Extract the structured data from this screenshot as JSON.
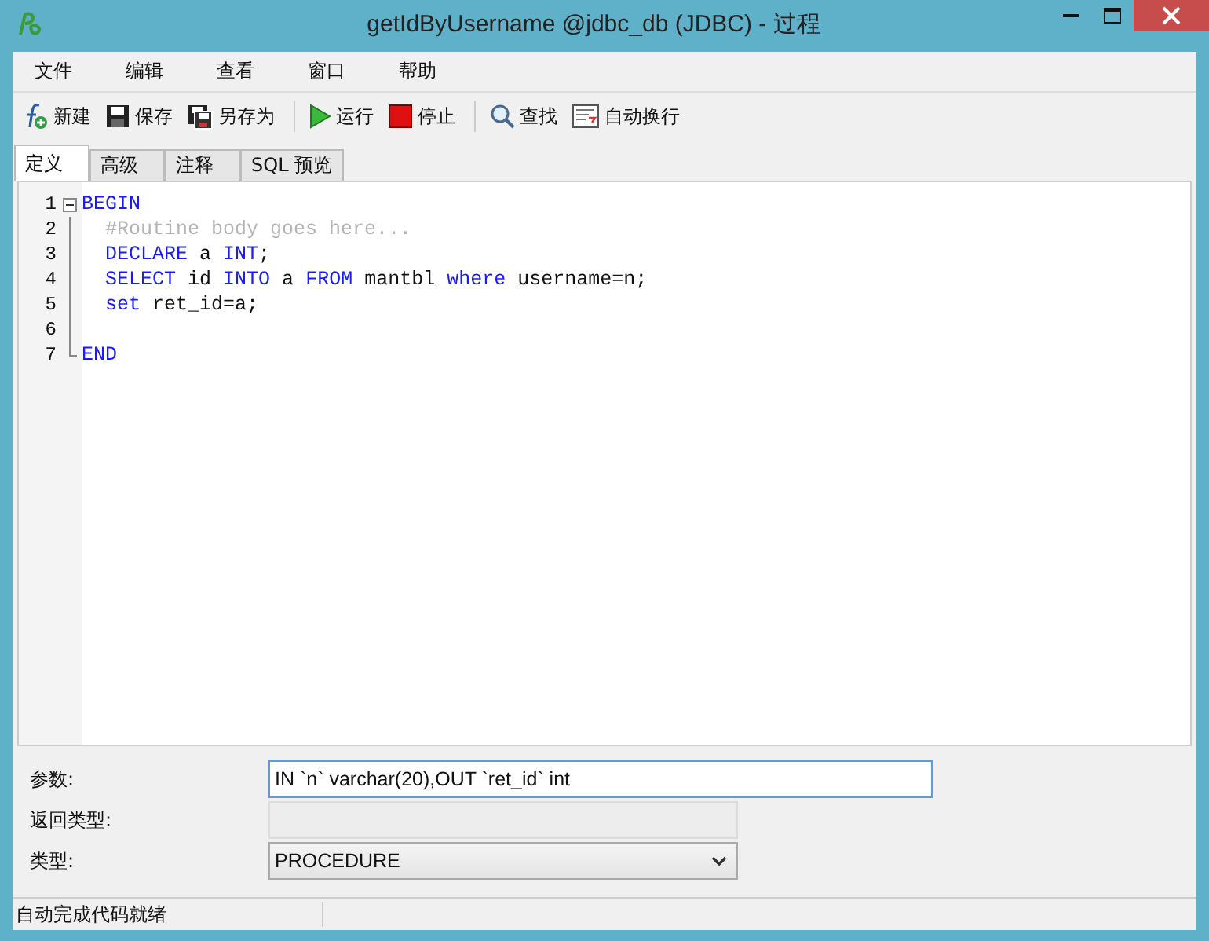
{
  "window": {
    "title": "getIdByUsername @jdbc_db (JDBC) - 过程"
  },
  "menu": [
    "文件",
    "编辑",
    "查看",
    "窗口",
    "帮助"
  ],
  "toolbar": [
    {
      "kind": "new",
      "label": "新建"
    },
    {
      "kind": "save",
      "label": "保存"
    },
    {
      "kind": "saveas",
      "label": "另存为"
    },
    {
      "kind": "run",
      "label": "运行",
      "group_start": true
    },
    {
      "kind": "stop",
      "label": "停止"
    },
    {
      "kind": "find",
      "label": "查找",
      "group_start": true
    },
    {
      "kind": "wrap",
      "label": "自动换行"
    }
  ],
  "tabs": [
    {
      "label": "定义",
      "selected": true
    },
    {
      "label": "高级",
      "selected": false
    },
    {
      "label": "注释",
      "selected": false
    },
    {
      "label": "SQL 预览",
      "selected": false
    }
  ],
  "editor": {
    "lines": [
      {
        "number": "1",
        "fold_start": true,
        "indented": false,
        "tokens": [
          {
            "text": "BEGIN",
            "kind": "keyword"
          }
        ]
      },
      {
        "number": "2",
        "indented": true,
        "tokens": [
          {
            "text": "#Routine body goes here...",
            "kind": "comment"
          }
        ]
      },
      {
        "number": "3",
        "indented": true,
        "tokens": [
          {
            "text": "DECLARE",
            "kind": "keyword"
          },
          {
            "text": " a ",
            "kind": "plain"
          },
          {
            "text": "INT",
            "kind": "keyword"
          },
          {
            "text": ";",
            "kind": "plain"
          }
        ]
      },
      {
        "number": "4",
        "indented": true,
        "tokens": [
          {
            "text": "SELECT",
            "kind": "keyword"
          },
          {
            "text": " id ",
            "kind": "plain"
          },
          {
            "text": "INTO",
            "kind": "keyword"
          },
          {
            "text": " a ",
            "kind": "plain"
          },
          {
            "text": "FROM",
            "kind": "keyword"
          },
          {
            "text": " mantbl ",
            "kind": "plain"
          },
          {
            "text": "where",
            "kind": "keyword"
          },
          {
            "text": " username=n;",
            "kind": "plain"
          }
        ]
      },
      {
        "number": "5",
        "indented": true,
        "tokens": [
          {
            "text": "set",
            "kind": "keyword"
          },
          {
            "text": " ret_id=a;",
            "kind": "plain"
          }
        ]
      },
      {
        "number": "6"
      },
      {
        "number": "7",
        "fold_end": true,
        "indented": false,
        "tokens": [
          {
            "text": "END",
            "kind": "keyword"
          }
        ]
      }
    ]
  },
  "form": [
    {
      "label": "参数:",
      "kind": "input",
      "value": "IN `n` varchar(20),OUT `ret_id` int"
    },
    {
      "label": "返回类型:",
      "kind": "disabled"
    },
    {
      "label": "类型:",
      "kind": "select",
      "value": "PROCEDURE"
    }
  ],
  "status_bar": "自动完成代码就绪"
}
